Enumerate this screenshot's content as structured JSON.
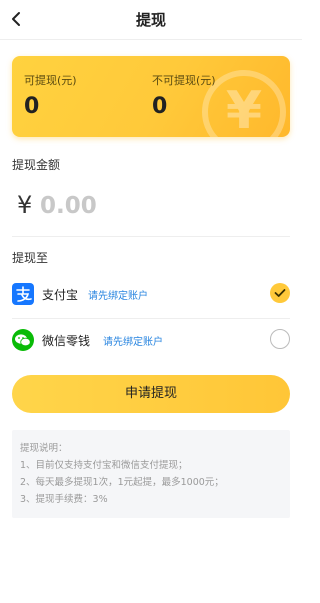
{
  "header": {
    "title": "提现",
    "back_icon": "back-arrow-icon"
  },
  "balance_card": {
    "available_label": "可提现(元)",
    "available_value": "0",
    "unavailable_label": "不可提现(元)",
    "unavailable_value": "0",
    "watermark_icon": "yen-icon",
    "colors": {
      "gradient_start": "#ffd23f",
      "gradient_end": "#ffb82c"
    }
  },
  "amount": {
    "label": "提现金额",
    "currency_symbol": "¥",
    "placeholder": "0.00",
    "value": ""
  },
  "destination": {
    "label": "提现至",
    "options": [
      {
        "name": "支付宝",
        "link": "请先绑定账户",
        "icon": "alipay-icon",
        "selected": true
      },
      {
        "name": "微信零钱",
        "link": "请先绑定账户",
        "icon": "wechat-icon",
        "selected": false
      }
    ]
  },
  "submit": {
    "label": "申请提现"
  },
  "notes": {
    "title": "提现说明：",
    "lines": [
      "1、目前仅支持支付宝和微信支付提现；",
      "2、每天最多提现1次，1元起提，最多1000元；",
      "3、提现手续费：3%"
    ]
  },
  "colors": {
    "accent": "#ffc93a",
    "link": "#2a86e0",
    "alipay": "#1677ff",
    "wechat": "#09bb07"
  }
}
